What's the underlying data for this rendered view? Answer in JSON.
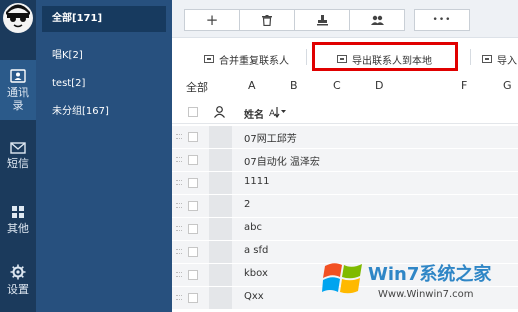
{
  "rail": {
    "items": [
      {
        "label": "通讯录",
        "icon": "contacts-icon"
      },
      {
        "label": "短信",
        "icon": "mail-icon"
      },
      {
        "label": "其他",
        "icon": "grid-icon"
      },
      {
        "label": "设置",
        "icon": "gear-icon"
      }
    ]
  },
  "groups": [
    {
      "label": "全部[171]"
    },
    {
      "label": "唱K[2]"
    },
    {
      "label": "test[2]"
    },
    {
      "label": "未分组[167]"
    }
  ],
  "toolbar": {
    "buttons": [
      {
        "label": "+",
        "icon": "plus-icon"
      },
      {
        "label": "",
        "icon": "trash-icon"
      },
      {
        "label": "",
        "icon": "stamp-icon"
      },
      {
        "label": "",
        "icon": "people-icon"
      },
      {
        "label": "•••",
        "icon": "more-icon"
      }
    ]
  },
  "actions": {
    "merge": "合并重复联系人",
    "export": "导出联系人到本地",
    "import": "导入"
  },
  "alphabet": {
    "all": "全部",
    "letters": [
      "A",
      "B",
      "C",
      "D",
      "F",
      "G"
    ]
  },
  "table": {
    "name_header": "姓名",
    "sort_glyph": "↓",
    "rows": [
      {
        "name": "07网工邱芳"
      },
      {
        "name": "07自动化 温泽宏"
      },
      {
        "name": "1111"
      },
      {
        "name": "2"
      },
      {
        "name": "abc"
      },
      {
        "name": "a sfd"
      },
      {
        "name": "kbox"
      },
      {
        "name": "Qxx"
      }
    ]
  },
  "watermark": {
    "title": "Win7系统之家",
    "url": "Www.Winwin7.com"
  },
  "colors": {
    "rail": "#1b3a5c",
    "groups": "#27507e",
    "highlight": "#e00000"
  }
}
